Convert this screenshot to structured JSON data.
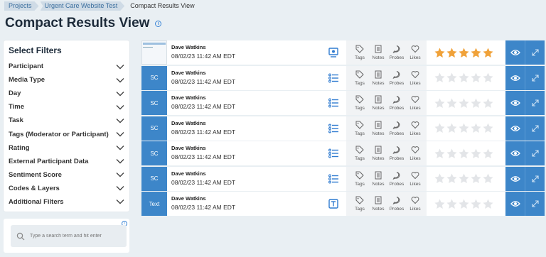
{
  "breadcrumb": [
    "Projects",
    "Urgent Care Website Test",
    "Compact Results View"
  ],
  "page": {
    "title": "Compact Results View"
  },
  "filters": {
    "heading": "Select Filters",
    "items": [
      "Participant",
      "Media Type",
      "Day",
      "Time",
      "Task",
      "Tags (Moderator or Participant)",
      "Rating",
      "External Participant Data",
      "Sentiment Score",
      "Codes & Layers",
      "Additional Filters"
    ]
  },
  "search": {
    "placeholder": "Type a search term and hit enter"
  },
  "action_labels": {
    "tags": "Tags",
    "notes": "Notes",
    "probes": "Probes",
    "likes": "Likes"
  },
  "colors": {
    "accent": "#3d86c9",
    "star_filled": "#f0a23a",
    "star_empty": "#e3e5e8"
  },
  "rows": [
    {
      "thumb": "",
      "thumb_type": "image",
      "name": "Dave Watkins",
      "date": "08/02/23 11:42 AM EDT",
      "type_icon": "monitor-icon",
      "rating": 5
    },
    {
      "thumb": "SC",
      "thumb_type": "sc",
      "name": "Dave Watkins",
      "date": "08/02/23 11:42 AM EDT",
      "type_icon": "list-icon",
      "rating": 0
    },
    {
      "thumb": "SC",
      "thumb_type": "sc",
      "name": "Dave Watkins",
      "date": "08/02/23 11:42 AM EDT",
      "type_icon": "list-icon",
      "rating": 0
    },
    {
      "thumb": "SC",
      "thumb_type": "sc",
      "name": "Dave Watkins",
      "date": "08/02/23 11:42 AM EDT",
      "type_icon": "list-icon",
      "rating": 0
    },
    {
      "thumb": "SC",
      "thumb_type": "sc",
      "name": "Dave Watkins",
      "date": "08/02/23 11:42 AM EDT",
      "type_icon": "list-icon",
      "rating": 0
    },
    {
      "thumb": "SC",
      "thumb_type": "sc",
      "name": "Dave Watkins",
      "date": "08/02/23 11:42 AM EDT",
      "type_icon": "list-icon",
      "rating": 0
    },
    {
      "thumb": "Text",
      "thumb_type": "text",
      "name": "Dave Watkins",
      "date": "08/02/23 11:42 AM EDT",
      "type_icon": "text-icon",
      "rating": 0
    }
  ]
}
